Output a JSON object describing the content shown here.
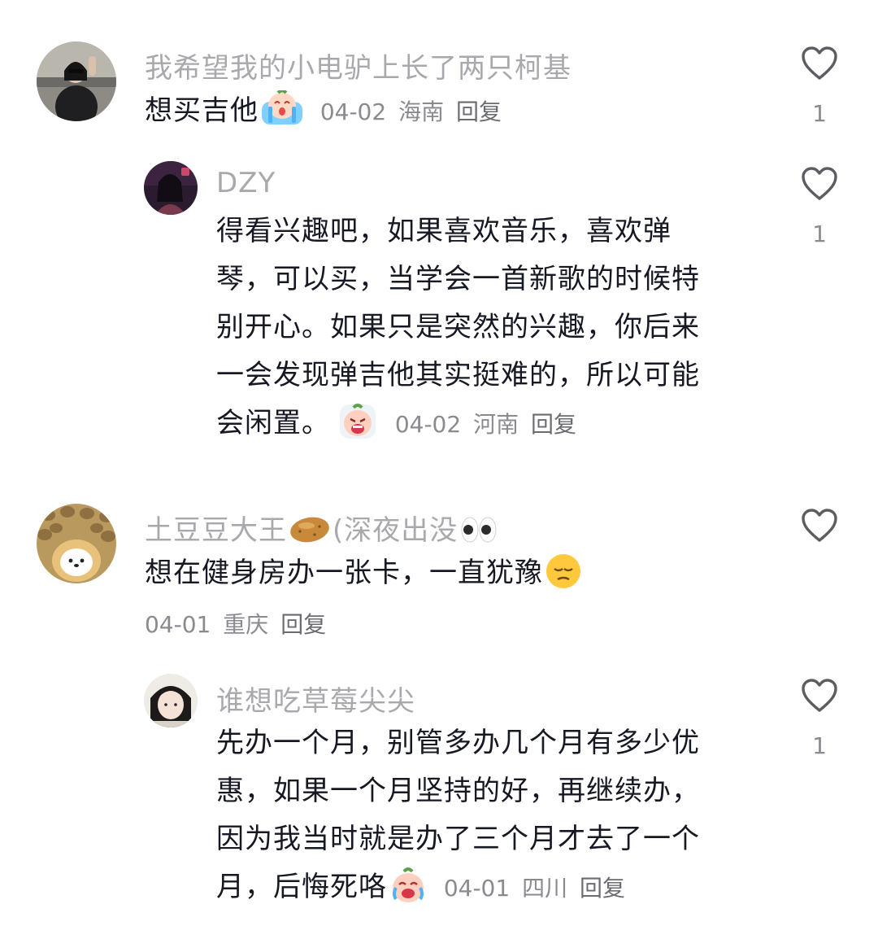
{
  "comments": [
    {
      "username": "我希望我的小电驴上长了两只柯基",
      "text": "想买吉他",
      "date": "04-02",
      "location": "海南",
      "reply_label": "回复",
      "likes": "1",
      "replies": [
        {
          "username": "DZY",
          "line1": "得看兴趣吧，如果喜欢音乐，喜欢弹",
          "line2": "琴，可以买，当学会一首新歌的时候特",
          "line3": "别开心。如果只是突然的兴趣，你后来",
          "line4": "一会发现弹吉他其实挺难的，所以可能",
          "line5": "会闲置。",
          "date": "04-02",
          "location": "河南",
          "reply_label": "回复",
          "likes": "1"
        }
      ]
    },
    {
      "username": "土豆豆大王",
      "username_suffix": "(深夜出没",
      "text": "想在健身房办一张卡，一直犹豫",
      "date": "04-01",
      "location": "重庆",
      "reply_label": "回复",
      "likes": "",
      "replies": [
        {
          "username": "谁想吃草莓尖尖",
          "line1": "先办一个月，别管多办几个月有多少优",
          "line2": "惠，如果一个月坚持的好，再继续办，",
          "line3": "因为我当时就是办了三个月才去了一个",
          "line4": "月，后悔死咯",
          "date": "04-01",
          "location": "四川",
          "reply_label": "回复",
          "likes": "1"
        }
      ]
    }
  ],
  "colors": {
    "username": "#a8a9ad",
    "text": "#161823",
    "meta": "#8a8b91",
    "heart_stroke": "#5c5d63"
  }
}
